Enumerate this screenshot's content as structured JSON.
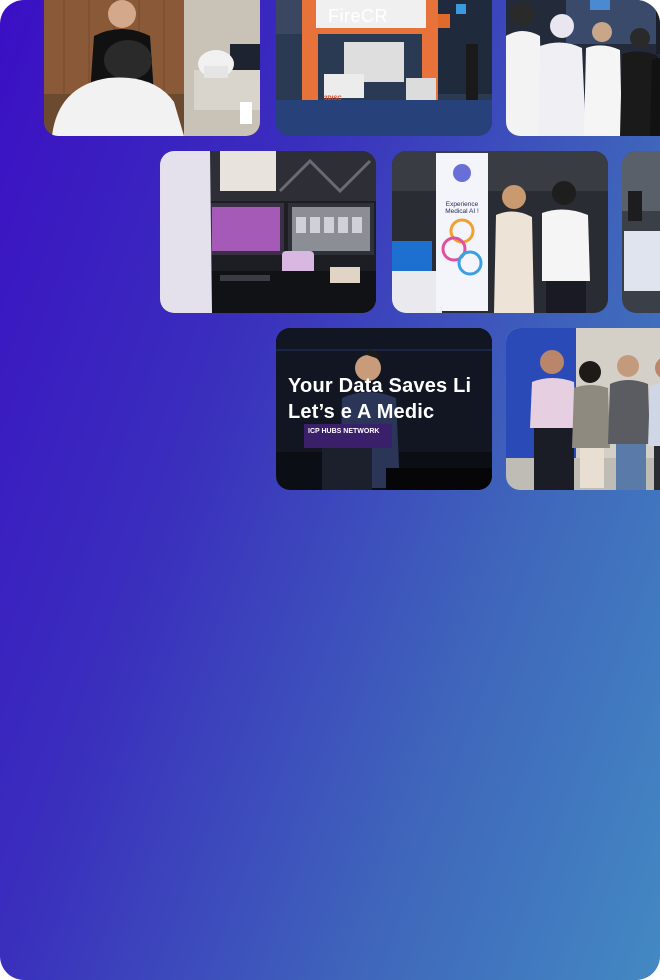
{
  "gallery": {
    "photos": [
      {
        "alt": "Person examining a dental scanner at a demo table"
      },
      {
        "alt": "FireCR trade show booth",
        "booth_sign": "FireCR",
        "booth_sub": "3DISC"
      },
      {
        "alt": "Attendees trying a VR headset"
      },
      {
        "alt": "Medical imaging workstation with monitors"
      },
      {
        "alt": "Booth visitors beside an Experience Medical AI banner",
        "banner_title": "Experience Medical AI !"
      },
      {
        "alt": "Partial photo of booth counter"
      },
      {
        "alt": "Speaker presenting on stage",
        "screen_line_1": "Your Data Saves Li",
        "screen_line_2": "Let’s        e A Medic",
        "podium_label": "ICP HUBS NETWORK"
      },
      {
        "alt": "Group photo of four people outdoors"
      }
    ]
  },
  "colors": {
    "gradient_start": "#3b0fc4",
    "gradient_end": "#4389c3"
  }
}
